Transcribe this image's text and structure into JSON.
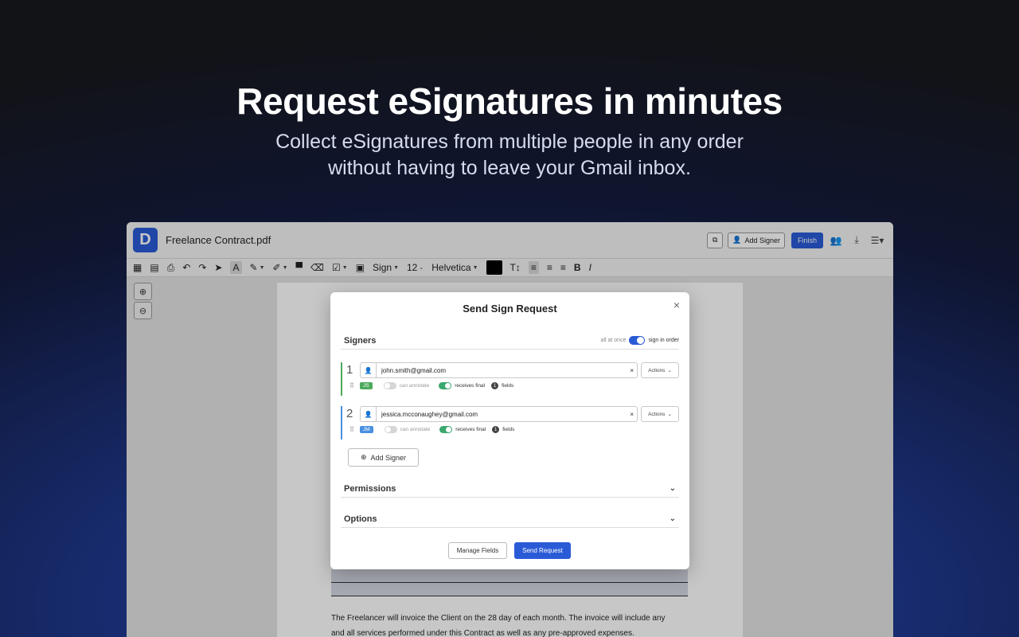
{
  "hero": {
    "title": "Request eSignatures in minutes",
    "subtitle_line1": "Collect eSignatures from multiple people in any order",
    "subtitle_line2": "without having to leave your Gmail inbox."
  },
  "app": {
    "logo_letter": "D",
    "filename": "Freelance Contract.pdf",
    "buttons": {
      "add_signer": "Add Signer",
      "finish": "Finish"
    },
    "toolbar": {
      "sign": "Sign",
      "font_size": "12",
      "font_family": "Helvetica"
    },
    "document": {
      "text_line1": "The Freelancer will invoice the Client on the 28 day of each month. The invoice will include any",
      "text_line2": "and all services performed under this Contract as well as any pre-approved expenses."
    }
  },
  "modal": {
    "title": "Send Sign Request",
    "close": "×",
    "signers_heading": "Signers",
    "toggle_left": "all at once",
    "toggle_right": "sign in order",
    "signers": [
      {
        "number": "1",
        "email": "john.smith@gmail.com",
        "initials": "JS",
        "color": "#4caa5c",
        "can_annotate": "can annotate",
        "receives_final": "receives final",
        "fields_count": "1",
        "fields_label": "fields",
        "actions": "Actions"
      },
      {
        "number": "2",
        "email": "jessica.mcconaughey@gmail.com",
        "initials": "JM",
        "color": "#4a8fe0",
        "can_annotate": "can annotate",
        "receives_final": "receives final",
        "fields_count": "1",
        "fields_label": "fields",
        "actions": "Actions"
      }
    ],
    "add_signer": "Add Signer",
    "permissions": "Permissions",
    "options": "Options",
    "manage_fields": "Manage Fields",
    "send_request": "Send Request"
  },
  "colors": {
    "accent": "#2a5bd7",
    "signer1": "#4caa5c",
    "signer2": "#4a8fe0"
  }
}
